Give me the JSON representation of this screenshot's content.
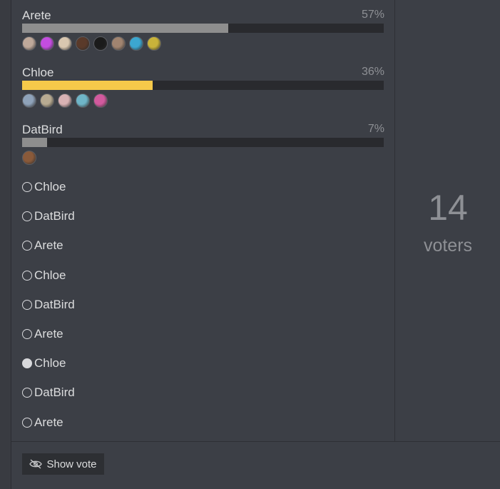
{
  "results": [
    {
      "label": "Arete",
      "percent_text": "57%",
      "fraction": 0.57,
      "color": "#8e8e8e",
      "avatars": [
        "#bfa99a",
        "#c44de0",
        "#d9c7b0",
        "#5a3a2a",
        "#1b1b1b",
        "#a08470",
        "#3ca7d0",
        "#c9b33a"
      ]
    },
    {
      "label": "Chloe",
      "percent_text": "36%",
      "fraction": 0.36,
      "color": "#f6c94a",
      "avatars": [
        "#8fa3ba",
        "#b8ab92",
        "#d8b2b4",
        "#6fb5c8",
        "#d25a9e"
      ]
    },
    {
      "label": "DatBird",
      "percent_text": "7%",
      "fraction": 0.07,
      "color": "#8e8e8e",
      "avatars": [
        "#8a5a3a"
      ]
    }
  ],
  "choices": [
    {
      "label": "Chloe",
      "selected": false
    },
    {
      "label": "DatBird",
      "selected": false
    },
    {
      "label": "Arete",
      "selected": false
    },
    {
      "label": "Chloe",
      "selected": false
    },
    {
      "label": "DatBird",
      "selected": false
    },
    {
      "label": "Arete",
      "selected": false
    },
    {
      "label": "Chloe",
      "selected": true
    },
    {
      "label": "DatBird",
      "selected": false
    },
    {
      "label": "Arete",
      "selected": false
    }
  ],
  "voters": {
    "count": "14",
    "label": "voters"
  },
  "footer": {
    "show_vote_label": "Show vote",
    "icon": "eye-off-icon"
  }
}
